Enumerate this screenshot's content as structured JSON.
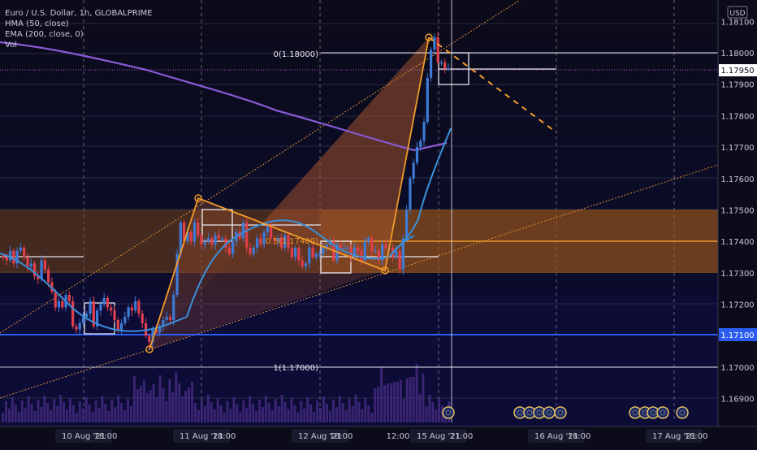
{
  "header": {
    "symbol_line": "Euro / U.S. Dollar, 1h, GLOBALPRIME",
    "indicators": [
      "HMA (50, close)",
      "EMA (200, close, 0)",
      "Vol"
    ]
  },
  "currency_label": "USD",
  "price_axis": {
    "ticks": [
      "1.18100",
      "1.18000",
      "1.17900",
      "1.17800",
      "1.17700",
      "1.17600",
      "1.17500",
      "1.17400",
      "1.17300",
      "1.17200",
      "1.17100",
      "1.17000",
      "1.16900"
    ],
    "current_price_tag": "1.17950",
    "highlight_tag": "1.17100"
  },
  "time_axis": {
    "labels": [
      "10 Aug '21",
      "18:00",
      "11 Aug '21",
      "18:00",
      "12 Aug '21",
      "18:00",
      "12:00",
      "15 Aug '21",
      "21:00",
      "16 Aug '21",
      "18:00",
      "17 Aug '21",
      "18:00"
    ]
  },
  "fib_labels": {
    "level_0": "0(1.18000)",
    "level_05": "0.5(1.17400)",
    "level_1": "1(1.17000)"
  },
  "colors": {
    "background": "#0b0b1e",
    "up_candle": "#3e7bd6",
    "down_candle": "#e0404c",
    "hma": "#3a8fd9",
    "ema": "#8a5ad6",
    "pattern": "#f29b2a",
    "horizontal_line": "#2a5cf0"
  },
  "chart_data": {
    "type": "candlestick",
    "title": "Euro / U.S. Dollar, 1h, GLOBALPRIME",
    "ylim": [
      1.1685,
      1.1815
    ],
    "y_ticks": [
      1.181,
      1.18,
      1.179,
      1.178,
      1.177,
      1.176,
      1.175,
      1.174,
      1.173,
      1.172,
      1.171,
      1.17,
      1.169
    ],
    "x_ticks": [
      "10 Aug '21",
      "18:00",
      "11 Aug '21",
      "18:00",
      "12 Aug '21",
      "18:00",
      "12:00",
      "15 Aug '21",
      "21:00",
      "16 Aug '21",
      "18:00",
      "17 Aug '21",
      "18:00"
    ],
    "series": [
      {
        "name": "EURUSD",
        "close": [
          1.1735,
          1.1734,
          1.1737,
          1.1733,
          1.1737,
          1.1738,
          1.1735,
          1.1732,
          1.1733,
          1.1729,
          1.1728,
          1.1734,
          1.1731,
          1.1727,
          1.1724,
          1.1719,
          1.1721,
          1.1719,
          1.1723,
          1.1721,
          1.1713,
          1.1712,
          1.1714,
          1.1716,
          1.1717,
          1.1721,
          1.1713,
          1.1718,
          1.172,
          1.1722,
          1.1719,
          1.1718,
          1.1715,
          1.1712,
          1.1714,
          1.1716,
          1.1719,
          1.1718,
          1.1721,
          1.1717,
          1.1714,
          1.171,
          1.1708,
          1.1712,
          1.1711,
          1.1713,
          1.1715,
          1.1716,
          1.1715,
          1.1723,
          1.1736,
          1.1746,
          1.174,
          1.1743,
          1.174,
          1.1746,
          1.1742,
          1.1739,
          1.174,
          1.1741,
          1.1739,
          1.1742,
          1.1741,
          1.1741,
          1.1738,
          1.1736,
          1.174,
          1.1743,
          1.1741,
          1.1746,
          1.1738,
          1.1736,
          1.1738,
          1.1741,
          1.1739,
          1.1743,
          1.1745,
          1.1741,
          1.174,
          1.1741,
          1.1738,
          1.1742,
          1.1738,
          1.1735,
          1.1738,
          1.1734,
          1.1732,
          1.1733,
          1.1738,
          1.1735,
          1.1736,
          1.1736,
          1.1738,
          1.1739,
          1.174,
          1.1734,
          1.1739,
          1.1738,
          1.1738,
          1.1738,
          1.1735,
          1.1738,
          1.1737,
          1.1734,
          1.174,
          1.1741,
          1.1737,
          1.1737,
          1.1734,
          1.1739,
          1.1738,
          1.1738,
          1.1735,
          1.1737,
          1.1731,
          1.1741,
          1.175,
          1.176,
          1.1765,
          1.177,
          1.1772,
          1.1778,
          1.1792,
          1.1801,
          1.1805,
          1.1797,
          1.1797,
          1.1795,
          1.1795
        ]
      },
      {
        "name": "HMA (50, close)",
        "line": "smoothed"
      },
      {
        "name": "EMA (200, close, 0)",
        "line": "smoothed"
      },
      {
        "name": "Vol",
        "type": "volume"
      }
    ],
    "annotations": [
      {
        "type": "fibonacci",
        "levels": [
          {
            "label": "0(1.18000)",
            "value": 1.18
          },
          {
            "label": "0.5(1.17400)",
            "value": 1.174
          },
          {
            "label": "1(1.17000)",
            "value": 1.17
          }
        ]
      },
      {
        "type": "horizontal_line",
        "value": 1.171
      },
      {
        "type": "zone",
        "from": 1.173,
        "to": 1.175
      }
    ]
  }
}
